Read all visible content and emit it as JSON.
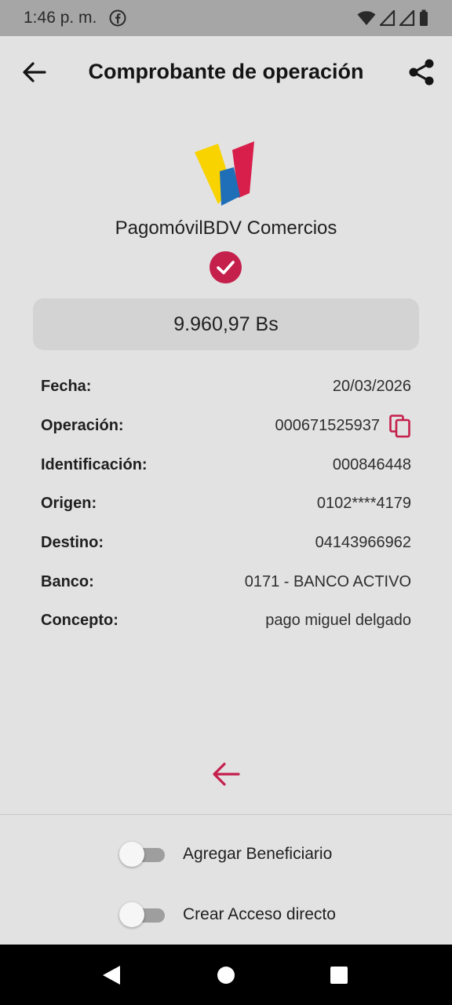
{
  "status_bar": {
    "time": "1:46 p. m.",
    "icons": [
      "facebook-icon",
      "wifi-icon",
      "signal-icon",
      "signal-icon",
      "battery-icon"
    ]
  },
  "app_bar": {
    "title": "Comprobante de operación",
    "back_icon": "arrow-left-icon",
    "share_icon": "share-icon"
  },
  "brand": {
    "name": "PagomóvilBDV Comercios",
    "logo_colors": [
      "#f8d300",
      "#1e6fb8",
      "#d81f4b"
    ]
  },
  "success_icon": "check-circle-icon",
  "accent_color": "#c51f4b",
  "amount": "9.960,97 Bs",
  "details": [
    {
      "label": "Fecha:",
      "value": "20/03/2026"
    },
    {
      "label": "Operación:",
      "value": "000671525937"
    },
    {
      "label": "Identificación:",
      "value": "000846448"
    },
    {
      "label": "Origen:",
      "value": "0102****4179"
    },
    {
      "label": "Destino:",
      "value": "04143966962"
    },
    {
      "label": "Banco:",
      "value": "0171 - BANCO ACTIVO"
    },
    {
      "label": "Concepto:",
      "value": "pago miguel delgado"
    }
  ],
  "copy_icon": "copy-icon",
  "return_icon": "arrow-left-icon",
  "toggles": [
    {
      "label": "Agregar Beneficiario",
      "checked": false
    },
    {
      "label": "Crear Acceso directo",
      "checked": false
    }
  ],
  "nav_bar": {
    "icons": [
      "nav-back-icon",
      "nav-home-icon",
      "nav-recents-icon"
    ]
  }
}
